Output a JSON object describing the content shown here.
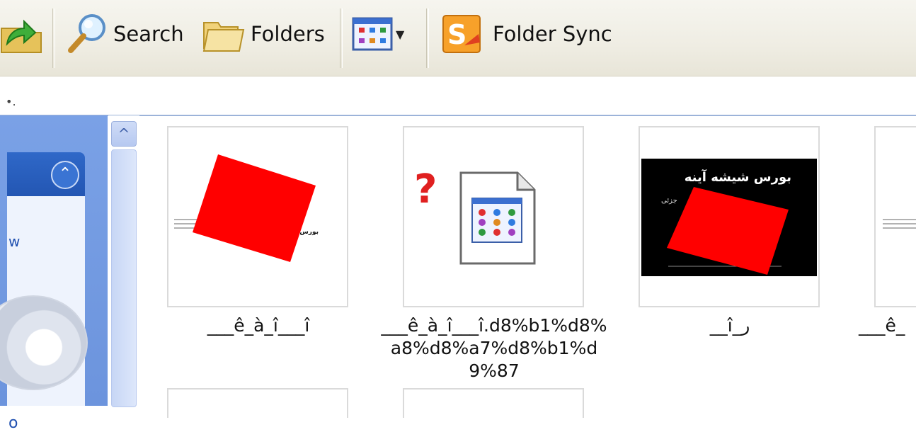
{
  "toolbar": {
    "search_label": "Search",
    "folders_label": "Folders",
    "folder_sync_label": "Folder Sync"
  },
  "files": [
    {
      "caption": "___ê_à_î___î"
    },
    {
      "caption": "___ê_à_î___î.d8%b1%d8%a8%d8%a7%d8%b1%d9%87"
    },
    {
      "caption": "__î_ر"
    },
    {
      "caption": "___ê_"
    }
  ],
  "thumb_text": {
    "persian_title": "بورس شیشه آینه",
    "persian_small": "بورس شیشه"
  },
  "colors": {
    "red": "#ff0000",
    "pane_blue": "#6c94dd"
  }
}
